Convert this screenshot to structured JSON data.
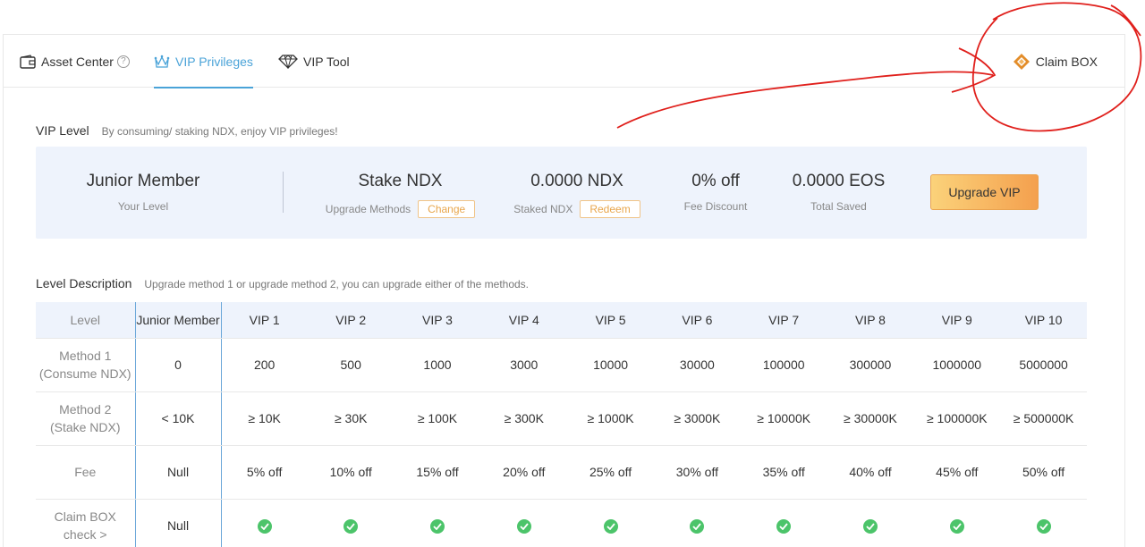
{
  "tabs": [
    {
      "label": "Asset Center",
      "icon": "wallet-icon"
    },
    {
      "label": "VIP Privileges",
      "icon": "crown-icon",
      "active": true
    },
    {
      "label": "VIP Tool",
      "icon": "diamond-icon"
    }
  ],
  "help_glyph": "?",
  "claim_box": {
    "label": "Claim BOX",
    "icon": "box-icon"
  },
  "vip_level": {
    "title": "VIP Level",
    "subtitle": "By consuming/ staking NDX, enjoy VIP privileges!",
    "current_level": {
      "value": "Junior Member",
      "label": "Your Level"
    },
    "upgrade_method": {
      "value": "Stake NDX",
      "label": "Upgrade Methods",
      "button": "Change"
    },
    "staked": {
      "value": "0.0000 NDX",
      "label": "Staked NDX",
      "button": "Redeem"
    },
    "fee_discount": {
      "value": "0% off",
      "label": "Fee Discount"
    },
    "total_saved": {
      "value": "0.0000 EOS",
      "label": "Total Saved"
    },
    "upgrade_button": "Upgrade VIP"
  },
  "level_description": {
    "title": "Level Description",
    "subtitle": "Upgrade method 1 or upgrade method 2, you can upgrade either of the methods.",
    "columns": [
      "Level",
      "Junior Member",
      "VIP 1",
      "VIP 2",
      "VIP 3",
      "VIP 4",
      "VIP 5",
      "VIP 6",
      "VIP 7",
      "VIP 8",
      "VIP 9",
      "VIP 10"
    ],
    "rows": [
      {
        "label": [
          "Method 1",
          "(Consume NDX)"
        ],
        "cells": [
          "0",
          "200",
          "500",
          "1000",
          "3000",
          "10000",
          "30000",
          "100000",
          "300000",
          "1000000",
          "5000000"
        ]
      },
      {
        "label": [
          "Method 2",
          "(Stake NDX)"
        ],
        "cells": [
          "<  10K",
          "≥ 10K",
          "≥ 30K",
          "≥ 100K",
          "≥ 300K",
          "≥ 1000K",
          "≥ 3000K",
          "≥ 10000K",
          "≥ 30000K",
          "≥ 100000K",
          "≥ 500000K"
        ]
      },
      {
        "label": [
          "Fee"
        ],
        "cells": [
          "Null",
          "5% off",
          "10% off",
          "15% off",
          "20% off",
          "25% off",
          "30% off",
          "35% off",
          "40% off",
          "45% off",
          "50% off"
        ]
      },
      {
        "label": [
          "Claim BOX",
          "check >"
        ],
        "cells": [
          "Null",
          "check",
          "check",
          "check",
          "check",
          "check",
          "check",
          "check",
          "check",
          "check",
          "check"
        ]
      }
    ]
  },
  "colors": {
    "accent": "#4aa3d8",
    "annotation": "#e0201c",
    "check": "#4cc46a",
    "upgrade_gradient": [
      "#fbd27a",
      "#f4a04e"
    ]
  }
}
